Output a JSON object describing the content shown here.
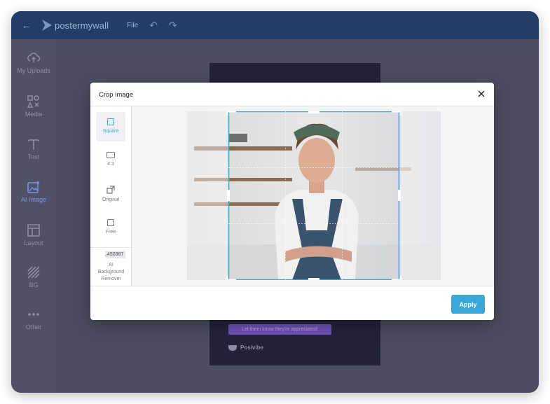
{
  "app": {
    "brand": "postermywall",
    "menu_file": "File"
  },
  "sidebar": {
    "items": [
      {
        "label": "My Uploads",
        "icon": "upload-cloud-icon"
      },
      {
        "label": "Media",
        "icon": "media-icon"
      },
      {
        "label": "Text",
        "icon": "text-icon"
      },
      {
        "label": "AI Image",
        "icon": "ai-image-icon",
        "active": true
      },
      {
        "label": "Layout",
        "icon": "layout-icon"
      },
      {
        "label": "BG",
        "icon": "background-icon"
      },
      {
        "label": "Other",
        "icon": "more-dots-icon"
      }
    ]
  },
  "poster": {
    "cta_text": "Let them know they're appreciated!",
    "brand_text": "Posivibe"
  },
  "modal": {
    "title": "Crop image",
    "options": [
      {
        "label": "Square",
        "selected": true
      },
      {
        "label": "4:3",
        "selected": false
      },
      {
        "label": "Original",
        "selected": false
      },
      {
        "label": "Free",
        "selected": false
      }
    ],
    "ai_option": {
      "badge": "450387",
      "label_line1": "AI",
      "label_line2": "Background",
      "label_line3": "Remover"
    },
    "apply_label": "Apply"
  },
  "colors": {
    "accent": "#3aa7d6",
    "topbar": "#233d67",
    "active_nav": "#7d96e6"
  }
}
